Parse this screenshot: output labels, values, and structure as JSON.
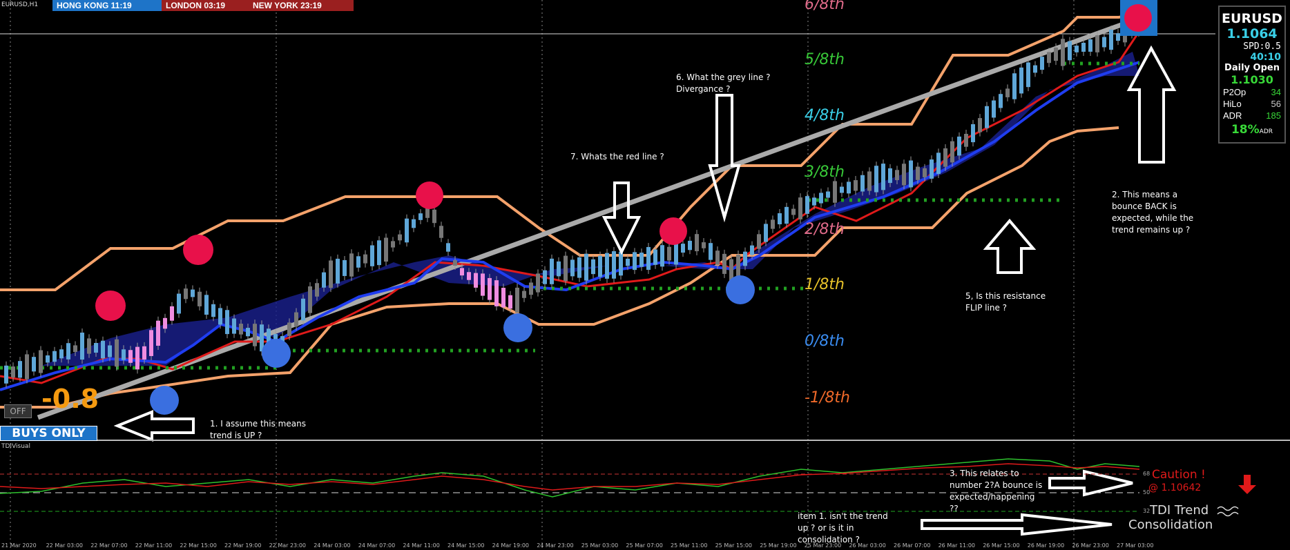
{
  "symbol_label": "EURUSD,H1",
  "sessions": [
    {
      "label": "HONG KONG  11:19",
      "color": "#1e74c8"
    },
    {
      "label": "LONDON   03:19",
      "color": "#9a1f1f"
    },
    {
      "label": "NEW YORK  23:19",
      "color": "#9a1f1f"
    }
  ],
  "murrey_levels": [
    {
      "label": "6/8th",
      "color": "#e06b8a"
    },
    {
      "label": "5/8th",
      "color": "#38c838"
    },
    {
      "label": "4/8th",
      "color": "#3ad0e8"
    },
    {
      "label": "3/8th",
      "color": "#38c838"
    },
    {
      "label": "2/8th",
      "color": "#e06b8a"
    },
    {
      "label": "1/8th",
      "color": "#e8c32a"
    },
    {
      "label": "0/8th",
      "color": "#3a8cf0"
    },
    {
      "label": "-1/8th",
      "color": "#f06a2a"
    }
  ],
  "info_panel": {
    "symbol": "EURUSD",
    "price": "1.1064",
    "spread": "SPD:0.5",
    "timer": "40:10",
    "daily_open_label": "Daily Open",
    "daily_open_value": "1.1030",
    "stats": [
      {
        "label": "P2Op",
        "value": "34"
      },
      {
        "label": "HiLo",
        "value": "56"
      },
      {
        "label": "ADR",
        "value": "185"
      }
    ],
    "adr_percent": "18%",
    "adr_suffix": "ADR"
  },
  "signal_value": "-0.8",
  "off_label": "OFF",
  "buys_only_label": "BUYS ONLY",
  "indicator_title": "TDIVisual",
  "tdi_level_labels": [
    "68",
    "50",
    "32"
  ],
  "caution_label": "Caution !",
  "caution_price": "@ 1.10642",
  "tdi_trend_label": "TDI Trend",
  "tdi_state_label": "Consolidation",
  "annotations": {
    "note1_line1": "1. I assume this means",
    "note1_line2": "trend is UP ?",
    "note2_line1": "2. This means a",
    "note2_line2": "bounce BACK is",
    "note2_line3": "expected, while the",
    "note2_line4": "trend remains up ?",
    "note3_line1": "3. This relates to",
    "note3_line2": "number 2?A bounce is",
    "note3_line3": "expected/happening",
    "note3_line4": "??",
    "note4_line1": "item 1. isn't the trend",
    "note4_line2": "up ? or is it in",
    "note4_line3": "consolidation ?",
    "note5_line1": "5, Is this resistance",
    "note5_line2": "FLIP line ?",
    "note6_line1": "6. What the grey line ?",
    "note6_line2": "Divergance ?",
    "note7": "7. Whats the red line ?"
  },
  "time_ticks": [
    "21 Mar 2020",
    "22 Mar 03:00",
    "22 Mar 07:00",
    "22 Mar 11:00",
    "22 Mar 15:00",
    "22 Mar 19:00",
    "22 Mar 23:00",
    "24 Mar 03:00",
    "24 Mar 07:00",
    "24 Mar 11:00",
    "24 Mar 15:00",
    "24 Mar 19:00",
    "24 Mar 23:00",
    "25 Mar 03:00",
    "25 Mar 07:00",
    "25 Mar 11:00",
    "25 Mar 15:00",
    "25 Mar 19:00",
    "25 Mar 23:00",
    "26 Mar 03:00",
    "26 Mar 07:00",
    "26 Mar 11:00",
    "26 Mar 15:00",
    "26 Mar 19:00",
    "26 Mar 23:00",
    "27 Mar 03:00"
  ],
  "colors": {
    "channel": "#f4a26b",
    "grey_line": "#aaaaaa",
    "red_line": "#e01a1a",
    "blue_line": "#1f3df0",
    "green_dots": "#22a122",
    "fill": "#1a2090",
    "bull_candle": "#5fa7d8",
    "bear_candle": "#f08ce0"
  }
}
